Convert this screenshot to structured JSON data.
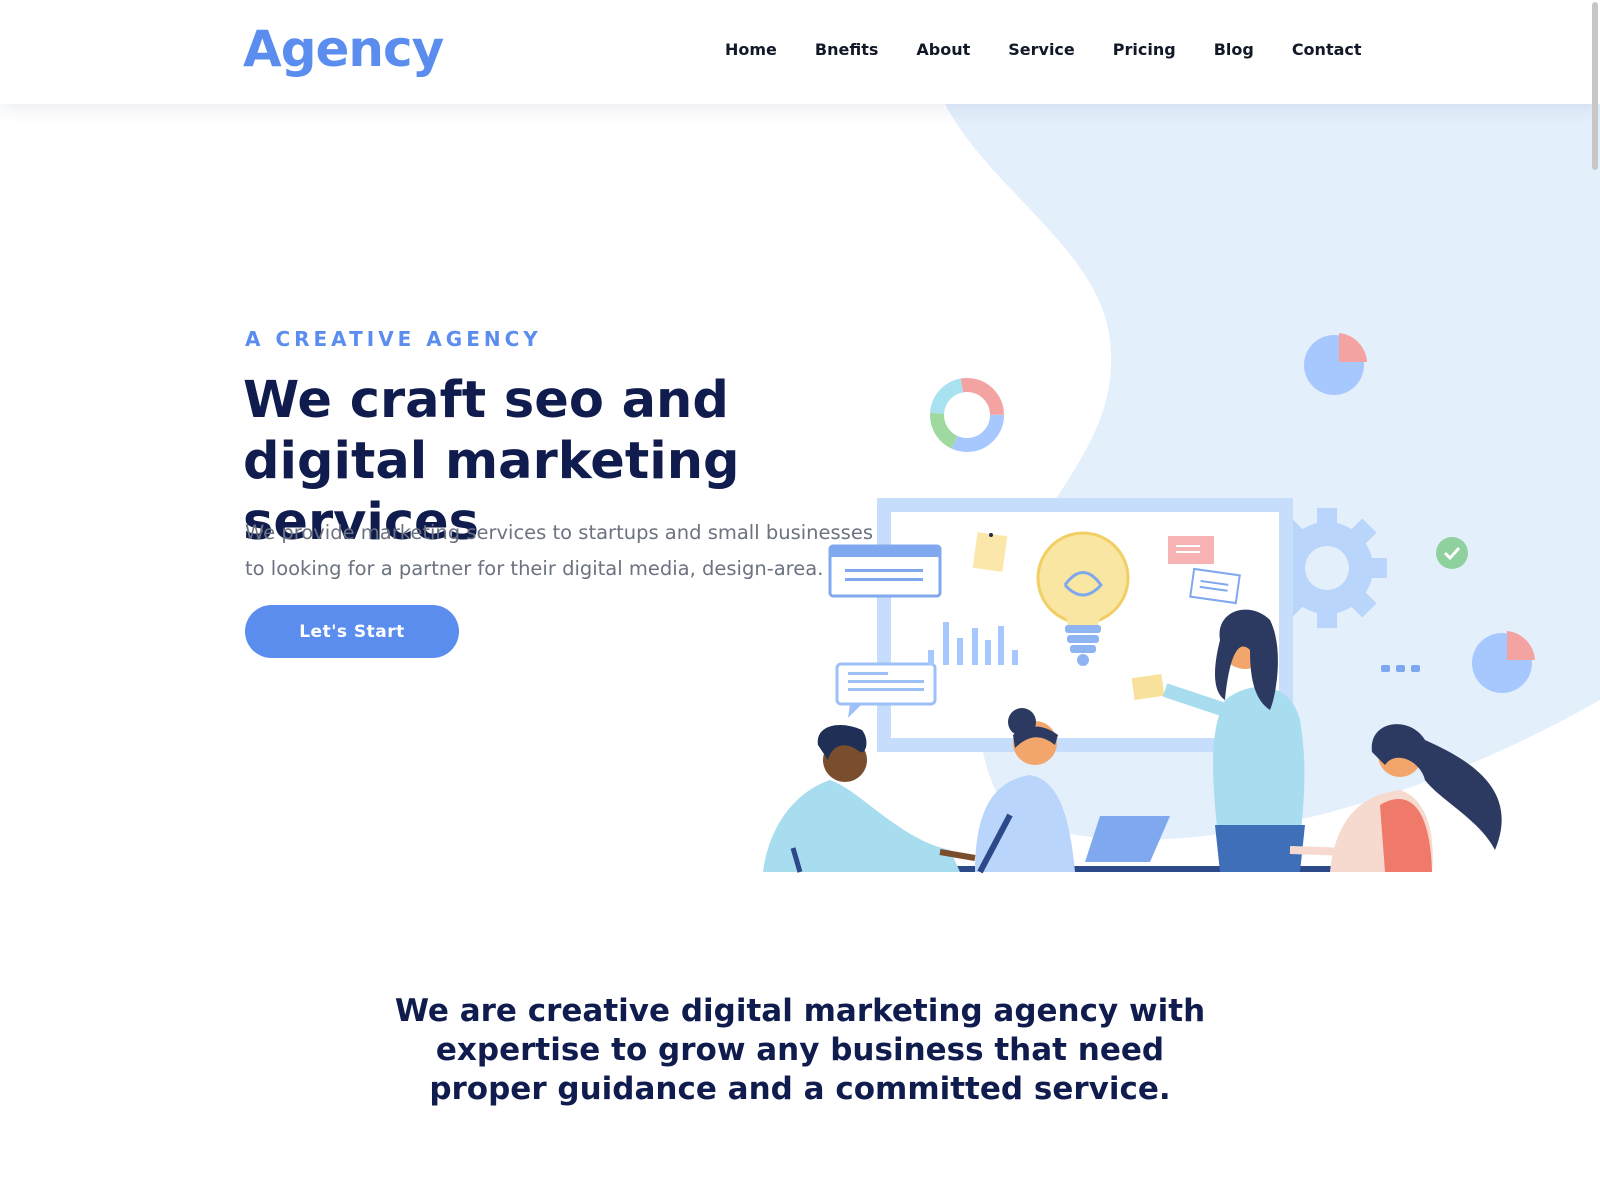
{
  "header": {
    "logo": "Agency",
    "nav": [
      "Home",
      "Bnefits",
      "About",
      "Service",
      "Pricing",
      "Blog",
      "Contact"
    ]
  },
  "hero": {
    "eyebrow": "A CREATIVE AGENCY",
    "title": "We craft seo and digital marketing services",
    "description": "We provide marketing services to startups and small businesses to looking for a partner for their digital media, design-area.",
    "cta_label": "Let's Start"
  },
  "about": {
    "statement": "We are creative digital marketing agency with expertise to grow any business that need proper guidance and a committed service."
  },
  "colors": {
    "accent": "#5b8def",
    "heading": "#0f1c4d",
    "body_text": "#6b7280",
    "hero_blob": "#e4effc"
  },
  "icons": [
    "donut-chart-icon",
    "pie-chart-icon",
    "gear-icon",
    "check-icon",
    "lightbulb-icon"
  ]
}
